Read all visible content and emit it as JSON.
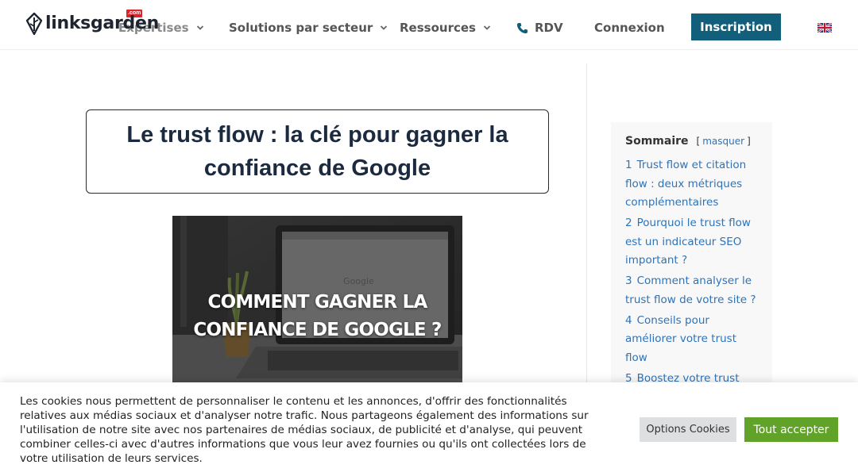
{
  "header": {
    "logo_text": "linksgarden",
    "logo_badge": ".com",
    "nav": [
      {
        "label": "Expertises",
        "has_dropdown": true
      },
      {
        "label": "Solutions par secteur",
        "has_dropdown": true
      },
      {
        "label": "Ressources",
        "has_dropdown": true
      },
      {
        "label": "RDV",
        "icon": "phone-icon"
      },
      {
        "label": "Connexion"
      }
    ],
    "signup_label": "Inscription",
    "language_icon": "uk-flag-icon"
  },
  "article": {
    "title": "Le trust flow : la clé pour gagner la confiance de Google",
    "hero_text_line1": "COMMENT GAGNER LA",
    "hero_text_line2": "CONFIANCE DE GOOGLE ?",
    "hero_screen_logo": "Google"
  },
  "toc": {
    "title": "Sommaire",
    "toggle_open": "[",
    "toggle_label": "masquer",
    "toggle_close": "]",
    "items": [
      {
        "num": "1",
        "text": "Trust flow et citation flow : deux métriques complémentaires"
      },
      {
        "num": "2",
        "text": "Pourquoi le trust flow est un indicateur SEO important ?"
      },
      {
        "num": "3",
        "text": "Comment analyser le trust flow de votre site ?"
      },
      {
        "num": "4",
        "text": "Conseils pour améliorer votre trust flow"
      },
      {
        "num": "5",
        "text": "Boostez votre trust flow avec Linksgarden"
      }
    ]
  },
  "cookie": {
    "text": "Les cookies nous permettent de personnaliser le contenu et les annonces, d'offrir des fonctionnalités relatives aux médias sociaux et d'analyser notre trafic. Nous partageons également des informations sur l'utilisation de notre site avec nos partenaires de médias sociaux, de publicité et d'analyse, qui peuvent combiner celles-ci avec d'autres informations que vous leur avez fournies ou qu'ils ont collectées lors de votre utilisation de leurs services.",
    "options_label": "Options Cookies",
    "accept_label": "Tout accepter"
  },
  "colors": {
    "signup_bg": "#125f7b",
    "accept_bg": "#61a229",
    "link": "#2e73b8",
    "title": "#1b2a3e"
  }
}
